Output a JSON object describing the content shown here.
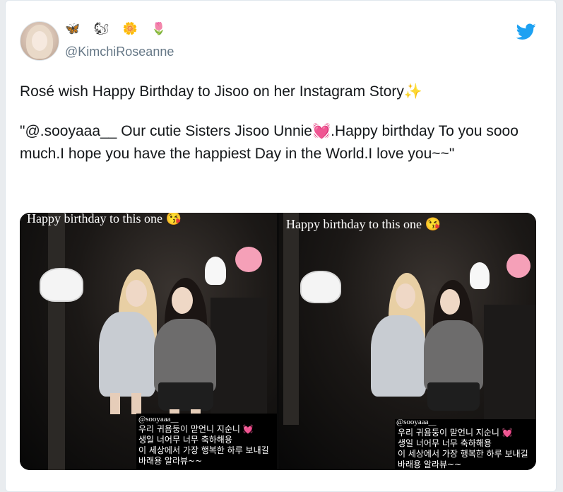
{
  "author": {
    "emojis": "🦋 🐿 🌼 🌷",
    "handle": "@KimchiRoseanne",
    "avatar_alt": ""
  },
  "brand": {
    "icon": "twitter-bird-icon",
    "color": "#1da1f2"
  },
  "tweet": {
    "line1": "Rosé wish Happy Birthday to Jisoo on her Instagram Story✨",
    "line2": "\"@.sooyaaa__ Our cutie Sisters Jisoo Unnie💓.Happy birthday To you sooo much.I hope you have the happiest Day in the World.I love you~~\""
  },
  "media": {
    "left": {
      "title": "Happy birthday to this one 😘",
      "mention": "@sooyaaa__",
      "caption_lines": [
        "우리 귀욤둥이 맏언니 지순니 💓",
        "생일 너어무 너무 축하해용",
        "이 세상에서 가장 행복한 하루 보내길",
        "바래용 알라뷰~~"
      ]
    },
    "right": {
      "title": "Happy birthday to this one 😘",
      "mention": "@sooyaaa__",
      "caption_lines": [
        "우리 귀욤둥이 맏언니 지순니 💓",
        "생일 너어무 너무 축하해용",
        "이 세상에서 가장 행복한 하루 보내길",
        "바래용 알라뷰~~"
      ]
    }
  },
  "colors": {
    "text": "#14171a",
    "secondary": "#657786",
    "border": "#e1e8ed"
  }
}
